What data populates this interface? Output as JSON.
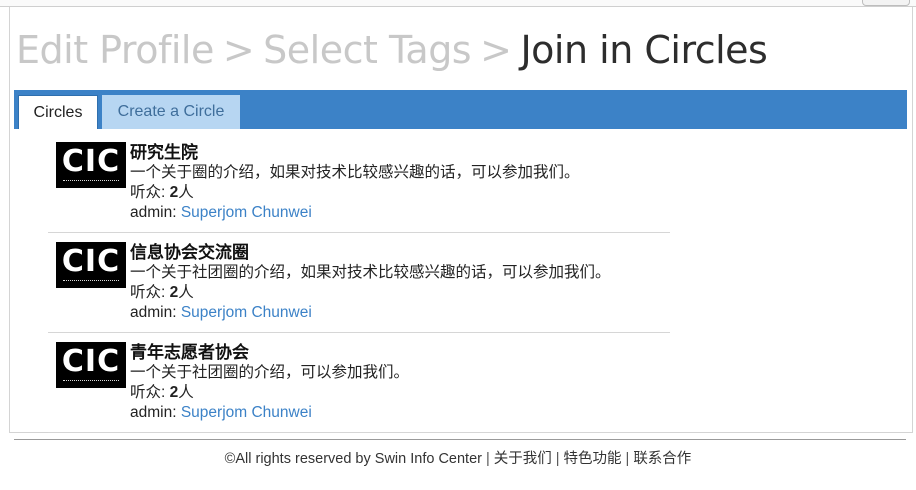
{
  "wizard": {
    "steps": [
      {
        "label": "Edit Profile"
      },
      {
        "label": "Select Tags"
      },
      {
        "label": "Join in Circles"
      }
    ],
    "separator": ">"
  },
  "tabs": [
    {
      "label": "Circles",
      "active": true
    },
    {
      "label": "Create a Circle",
      "active": false
    }
  ],
  "circles": [
    {
      "logo_text": "CIC",
      "name": "研究生院",
      "description": "一个关于圈的介绍，如果对技术比较感兴趣的话，可以参加我们。",
      "audience_label": "听众: ",
      "audience_count": "2",
      "audience_unit": "人",
      "admin_label": "admin: ",
      "admin_name": "Superjom Chunwei"
    },
    {
      "logo_text": "CIC",
      "name": "信息协会交流圈",
      "description": "一个关于社团圈的介绍，如果对技术比较感兴趣的话，可以参加我们。",
      "audience_label": "听众: ",
      "audience_count": "2",
      "audience_unit": "人",
      "admin_label": "admin: ",
      "admin_name": "Superjom Chunwei"
    },
    {
      "logo_text": "CIC",
      "name": "青年志愿者协会",
      "description": "一个关于社团圈的介绍，可以参加我们。",
      "audience_label": "听众: ",
      "audience_count": "2",
      "audience_unit": "人",
      "admin_label": "admin: ",
      "admin_name": "Superjom Chunwei"
    }
  ],
  "footer": {
    "copyright": "©All rights reserved by Swin Info Center",
    "separator": "|",
    "links": [
      "关于我们",
      "特色功能",
      "联系合作"
    ]
  },
  "colors": {
    "accent": "#3c82c7",
    "inactive_tab": "#b7d6f2",
    "wizard_inactive": "#c8c8c8",
    "wizard_active": "#2d2d2d"
  }
}
